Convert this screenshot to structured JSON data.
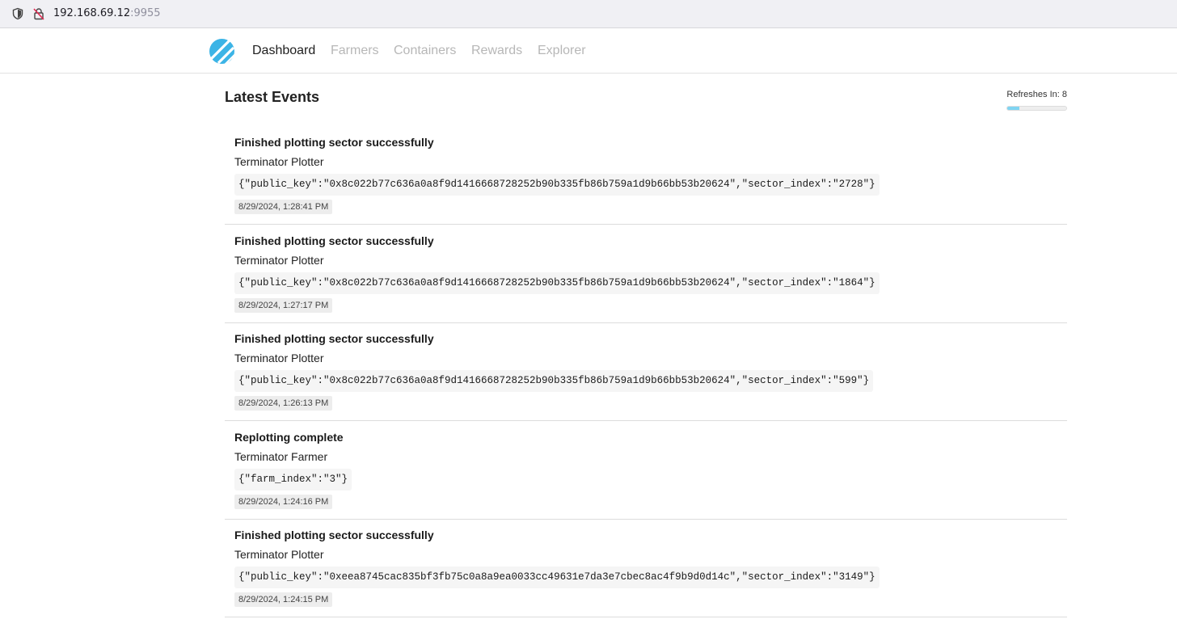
{
  "browser": {
    "url_host": "192.168.69.12",
    "url_port": ":9955"
  },
  "nav": {
    "items": [
      {
        "label": "Dashboard",
        "active": true
      },
      {
        "label": "Farmers",
        "active": false
      },
      {
        "label": "Containers",
        "active": false
      },
      {
        "label": "Rewards",
        "active": false
      },
      {
        "label": "Explorer",
        "active": false
      }
    ]
  },
  "main": {
    "title": "Latest Events",
    "refresh_label": "Refreshes In: 8",
    "refresh_progress_fraction": 0.2
  },
  "events": [
    {
      "title": "Finished plotting sector successfully",
      "source": "Terminator Plotter",
      "payload": "{\"public_key\":\"0x8c022b77c636a0a8f9d1416668728252b90b335fb86b759a1d9b66bb53b20624\",\"sector_index\":\"2728\"}",
      "time": "8/29/2024, 1:28:41 PM"
    },
    {
      "title": "Finished plotting sector successfully",
      "source": "Terminator Plotter",
      "payload": "{\"public_key\":\"0x8c022b77c636a0a8f9d1416668728252b90b335fb86b759a1d9b66bb53b20624\",\"sector_index\":\"1864\"}",
      "time": "8/29/2024, 1:27:17 PM"
    },
    {
      "title": "Finished plotting sector successfully",
      "source": "Terminator Plotter",
      "payload": "{\"public_key\":\"0x8c022b77c636a0a8f9d1416668728252b90b335fb86b759a1d9b66bb53b20624\",\"sector_index\":\"599\"}",
      "time": "8/29/2024, 1:26:13 PM"
    },
    {
      "title": "Replotting complete",
      "source": "Terminator Farmer",
      "payload": "{\"farm_index\":\"3\"}",
      "time": "8/29/2024, 1:24:16 PM"
    },
    {
      "title": "Finished plotting sector successfully",
      "source": "Terminator Plotter",
      "payload": "{\"public_key\":\"0xeea8745cac835bf3fb75c0a8a9ea0033cc49631e7da3e7cbec8ac4f9b9d0d14c\",\"sector_index\":\"3149\"}",
      "time": "8/29/2024, 1:24:15 PM"
    }
  ],
  "colors": {
    "accent": "#3cb4e6",
    "progress_fill": "#7fd4f2"
  },
  "icons": [
    "shield-icon",
    "insecure-lock-icon",
    "app-logo"
  ]
}
